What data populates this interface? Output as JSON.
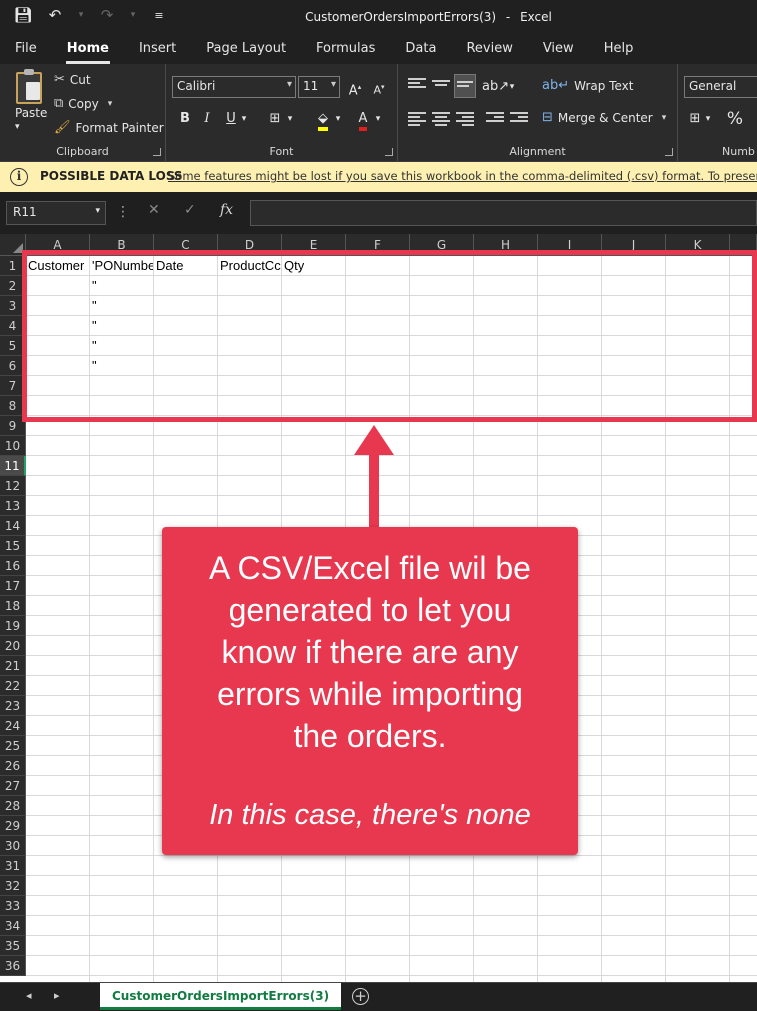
{
  "window": {
    "title": "CustomerOrdersImportErrors(3)",
    "separator": "-",
    "app": "Excel"
  },
  "qat": {
    "save_icon": "save-icon",
    "undo_icon": "undo-icon",
    "redo_icon": "redo-icon",
    "customize_icon": "customize-icon"
  },
  "menu": {
    "tabs": [
      "File",
      "Home",
      "Insert",
      "Page Layout",
      "Formulas",
      "Data",
      "Review",
      "View",
      "Help"
    ],
    "active": "Home"
  },
  "ribbon": {
    "clipboard": {
      "paste": "Paste",
      "cut": "Cut",
      "copy": "Copy",
      "format_painter": "Format Painter",
      "label": "Clipboard"
    },
    "font": {
      "name": "Calibri",
      "size": "11",
      "bold": "B",
      "italic": "I",
      "underline": "U",
      "label": "Font"
    },
    "alignment": {
      "wrap_text": "Wrap Text",
      "merge_center": "Merge & Center",
      "label": "Alignment"
    },
    "number": {
      "format": "General",
      "percent": "%",
      "label": "Numb"
    }
  },
  "warning": {
    "title": "POSSIBLE DATA LOSS",
    "message": "Some features might be lost if you save this workbook in the comma-delimited (.csv) format. To preserve these f"
  },
  "formula_bar": {
    "name_box": "R11",
    "fx": "fx",
    "value": ""
  },
  "grid": {
    "columns": [
      "A",
      "B",
      "C",
      "D",
      "E",
      "F",
      "G",
      "H",
      "I",
      "J",
      "K"
    ],
    "rows": [
      "1",
      "2",
      "3",
      "4",
      "5",
      "6",
      "7",
      "8",
      "9",
      "10",
      "11",
      "12",
      "13",
      "14",
      "15",
      "16",
      "17",
      "18",
      "19",
      "20",
      "21",
      "22",
      "23",
      "24",
      "25",
      "26",
      "27",
      "28",
      "29",
      "30",
      "31",
      "32",
      "33",
      "34",
      "35",
      "36"
    ],
    "active_row": "11",
    "cells": {
      "A1": "Customer",
      "B1": "'PONumbe",
      "C1": "Date",
      "D1": "ProductCc",
      "E1": "Qty",
      "B2": "\"",
      "B3": "\"",
      "B4": "\"",
      "B5": "\"",
      "B6": "\""
    }
  },
  "callout": {
    "lines": [
      "A CSV/Excel file wil be",
      "generated to let you",
      "know if there are any",
      "errors while importing",
      "the orders."
    ],
    "note": "In this case, there's none",
    "color": "#e8384f"
  },
  "sheets": {
    "tabs": [
      "CustomerOrdersImportErrors(3)"
    ],
    "active": "CustomerOrdersImportErrors(3)",
    "add": "+"
  }
}
